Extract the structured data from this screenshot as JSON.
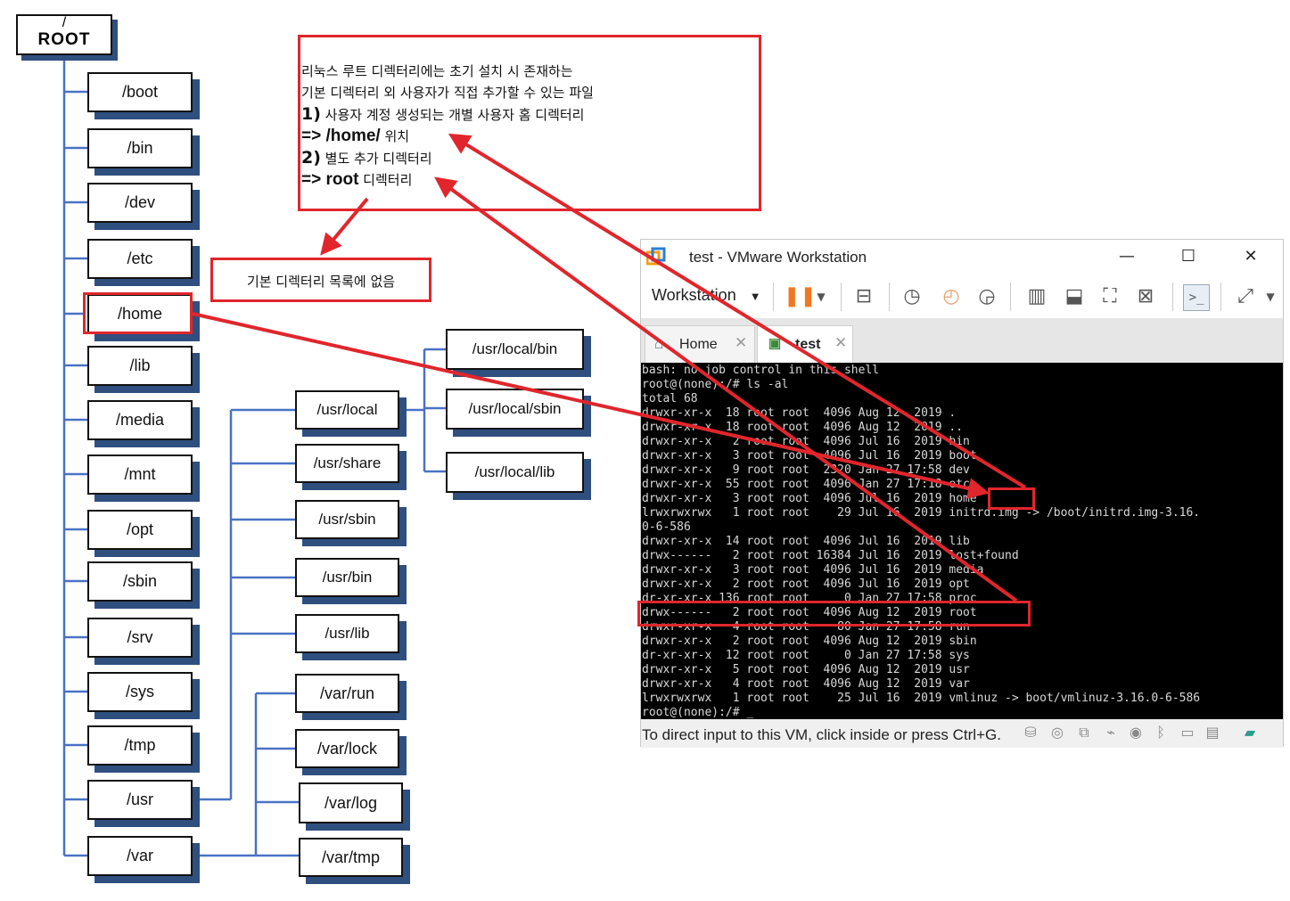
{
  "tree": {
    "root_slash": "/",
    "root_label": "ROOT",
    "top_dirs": [
      "/boot",
      "/bin",
      "/dev",
      "/etc",
      "/home",
      "/lib",
      "/media",
      "/mnt",
      "/opt",
      "/sbin",
      "/srv",
      "/sys",
      "/tmp",
      "/usr",
      "/var"
    ],
    "usr_dirs": [
      "/usr/local",
      "/usr/share",
      "/usr/sbin",
      "/usr/bin",
      "/usr/lib"
    ],
    "usr_local_dirs": [
      "/usr/local/bin",
      "/usr/local/sbin",
      "/usr/local/lib"
    ],
    "var_dirs": [
      "/var/run",
      "/var/lock",
      "/var/log",
      "/var/tmp"
    ]
  },
  "note": {
    "line1": "리눅스 루트 디렉터리에는 초기 설치 시 존재하는",
    "line2": "기본 디렉터리 외 사용자가 직접 추가할 수 있는 파일",
    "line3_num": "1)",
    "line3_text": " 사용자 계정 생성되는 개별 사용자 홈 디렉터리",
    "line4_arrow": "=> /home/",
    "line4_text": " 위치",
    "line5_num": "2)",
    "line5_text": " 별도 추가 디렉터리",
    "line6_arrow": "=> root",
    "line6_text": " 디렉터리"
  },
  "callout": {
    "text": "기본 디렉터리 목록에 없음"
  },
  "vm": {
    "title": "test - VMware Workstation",
    "controls": {
      "minimize": "—",
      "maximize": "☐",
      "close": "✕"
    },
    "menu_label": "Workstation",
    "tabs": [
      {
        "label": "Home",
        "close": "✕"
      },
      {
        "label": "test",
        "close": "✕"
      }
    ],
    "terminal_lines": [
      "bash: no job control in this shell",
      "root@(none):/# ls -al",
      "total 68",
      "drwxr-xr-x  18 root root  4096 Aug 12  2019 .",
      "drwxr-xr-x  18 root root  4096 Aug 12  2019 ..",
      "drwxr-xr-x   2 root root  4096 Jul 16  2019 bin",
      "drwxr-xr-x   3 root root  4096 Jul 16  2019 boot",
      "drwxr-xr-x   9 root root  2320 Jan 27 17:58 dev",
      "drwxr-xr-x  55 root root  4096 Jan 27 17:18 etc",
      "drwxr-xr-x   3 root root  4096 Jul 16  2019 home",
      "lrwxrwxrwx   1 root root    29 Jul 16  2019 initrd.img -> /boot/initrd.img-3.16.",
      "0-6-586",
      "drwxr-xr-x  14 root root  4096 Jul 16  2019 lib",
      "drwx------   2 root root 16384 Jul 16  2019 lost+found",
      "drwxr-xr-x   3 root root  4096 Jul 16  2019 media",
      "drwxr-xr-x   2 root root  4096 Jul 16  2019 opt",
      "dr-xr-xr-x 136 root root     0 Jan 27 17:58 proc",
      "drwx------   2 root root  4096 Aug 12  2019 root",
      "drwxr-xr-x   4 root root    80 Jan 27 17:58 run",
      "drwxr-xr-x   2 root root  4096 Aug 12  2019 sbin",
      "dr-xr-xr-x  12 root root     0 Jan 27 17:58 sys",
      "drwxr-xr-x   5 root root  4096 Aug 12  2019 usr",
      "drwxr-xr-x   4 root root  4096 Aug 12  2019 var",
      "lrwxrwxrwx   1 root root    25 Jul 16  2019 vmlinuz -> boot/vmlinuz-3.16.0-6-586",
      "root@(none):/# _"
    ],
    "status_text": "To direct input to this VM, click inside or press Ctrl+G."
  },
  "colors": {
    "highlight_red": "#e0262c",
    "tree_line_blue": "#4a72c4",
    "shadow": "#2f4f7f"
  }
}
